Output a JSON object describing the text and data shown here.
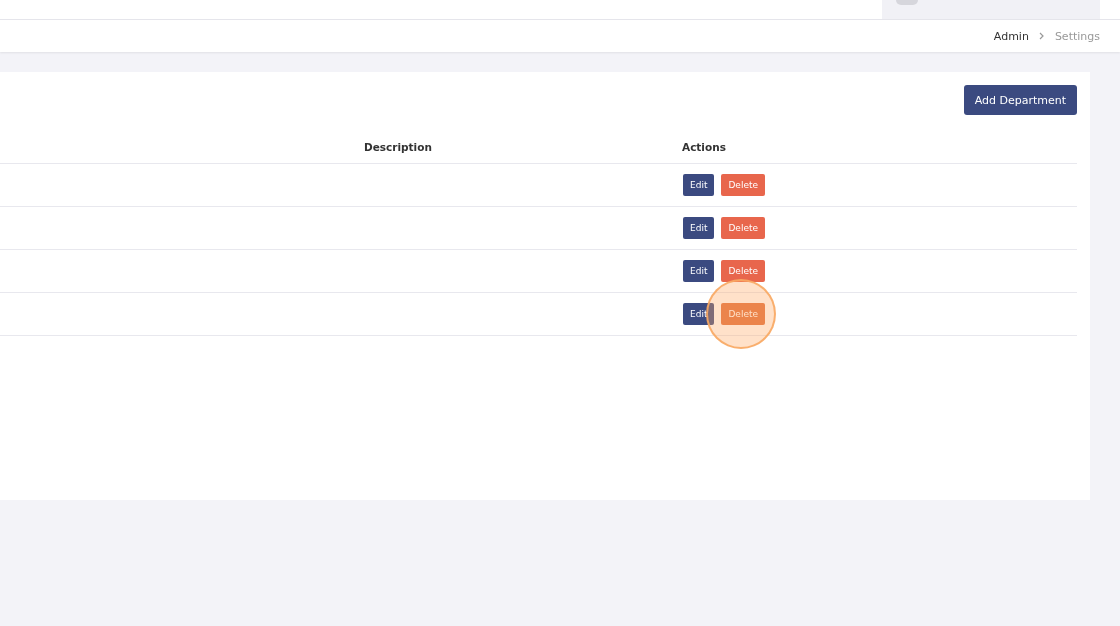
{
  "breadcrumb": [
    {
      "label": "Admin",
      "selected": false
    },
    {
      "label": "Settings",
      "selected": true
    }
  ],
  "add_button": "Add Department",
  "table": {
    "columns": [
      "Description",
      "Actions"
    ],
    "rows": [
      {
        "edit": "Edit",
        "delete": "Delete",
        "highlighted": false
      },
      {
        "edit": "Edit",
        "delete": "Delete",
        "highlighted": false
      },
      {
        "edit": "Edit",
        "delete": "Delete",
        "highlighted": false
      },
      {
        "edit": "Edit",
        "delete": "Delete",
        "highlighted": true
      }
    ]
  }
}
